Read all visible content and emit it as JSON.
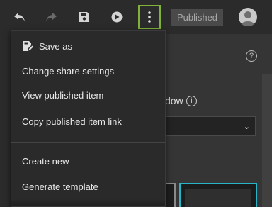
{
  "toolbar": {
    "undo_icon": "undo-icon",
    "redo_icon": "redo-icon",
    "save_icon": "save-icon",
    "play_icon": "play-icon",
    "more_icon": "more-vertical-icon",
    "published_label": "Published",
    "avatar_icon": "user-avatar-icon",
    "highlight_color": "#7fb33a"
  },
  "menu": {
    "items": [
      {
        "label": "Save as",
        "icon": "save-as-icon"
      },
      {
        "label": "Change share settings"
      },
      {
        "label": "View published item"
      },
      {
        "label": "Copy published item link"
      },
      {
        "label": "Create new"
      },
      {
        "label": "Generate template"
      }
    ]
  },
  "panel": {
    "window_label": "dow",
    "help_glyph": "?",
    "info_glyph": "i",
    "select_chevron": "⌄",
    "selected_thumb_color": "#29b5c9"
  }
}
